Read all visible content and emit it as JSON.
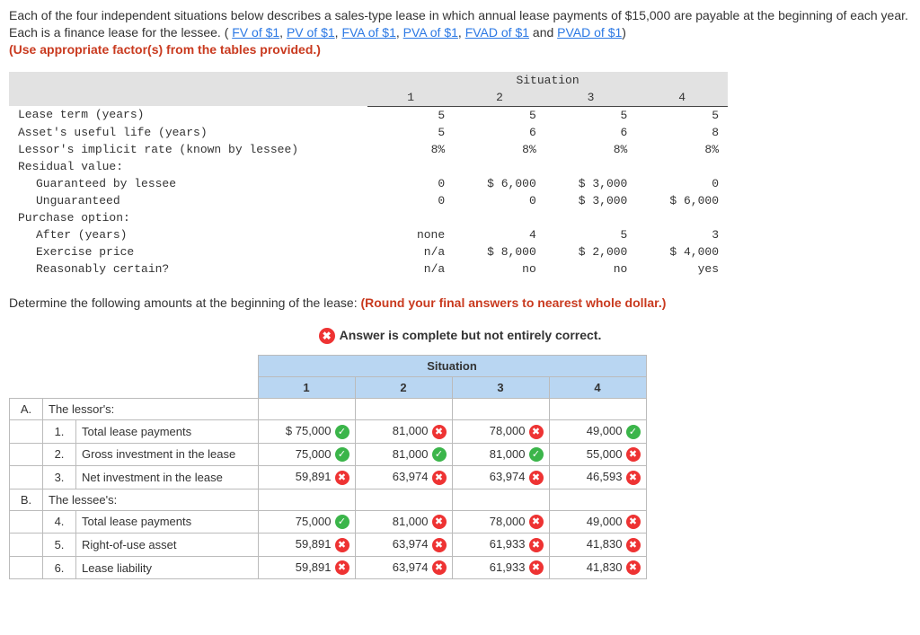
{
  "intro": {
    "text_a": "Each of the four independent situations below describes a sales-type lease in which annual lease payments of $15,000 are payable at the beginning of each year. Each is a finance lease for the lessee. (",
    "links": [
      "FV of $1",
      "PV of $1",
      "FVA of $1",
      "PVA of $1",
      "FVAD of $1",
      "PVAD of $1"
    ],
    "text_b": " and ",
    "closing": ")",
    "red_text": "(Use appropriate factor(s) from the tables provided.)"
  },
  "situation": {
    "header": "Situation",
    "cols": [
      "1",
      "2",
      "3",
      "4"
    ],
    "rows": [
      {
        "label": "Lease term (years)",
        "v": [
          "5",
          "5",
          "5",
          "5"
        ]
      },
      {
        "label": "Asset's useful life (years)",
        "v": [
          "5",
          "6",
          "6",
          "8"
        ]
      },
      {
        "label": "Lessor's implicit rate (known by lessee)",
        "v": [
          "8%",
          "8%",
          "8%",
          "8%"
        ]
      },
      {
        "label": "Residual value:",
        "v": [
          "",
          "",
          "",
          ""
        ]
      },
      {
        "label": "Guaranteed by lessee",
        "indent": 1,
        "v": [
          "0",
          "$ 6,000",
          "$ 3,000",
          "0"
        ]
      },
      {
        "label": "Unguaranteed",
        "indent": 1,
        "v": [
          "0",
          "0",
          "$ 3,000",
          "$ 6,000"
        ]
      },
      {
        "label": "Purchase option:",
        "v": [
          "",
          "",
          "",
          ""
        ]
      },
      {
        "label": "After (years)",
        "indent": 1,
        "v": [
          "none",
          "4",
          "5",
          "3"
        ]
      },
      {
        "label": "Exercise price",
        "indent": 1,
        "v": [
          "n/a",
          "$ 8,000",
          "$ 2,000",
          "$ 4,000"
        ]
      },
      {
        "label": "Reasonably certain?",
        "indent": 1,
        "v": [
          "n/a",
          "no",
          "no",
          "yes"
        ]
      }
    ]
  },
  "instruction": {
    "text": "Determine the following amounts at the beginning of the lease: ",
    "red": "(Round your final answers to nearest whole dollar.)"
  },
  "banner": "Answer is complete but not entirely correct.",
  "answer": {
    "header": "Situation",
    "cols": [
      "1",
      "2",
      "3",
      "4"
    ],
    "sections": [
      {
        "letter": "A.",
        "title": "The lessor's:",
        "rows": [
          {
            "num": "1.",
            "label": "Total lease payments",
            "vals": [
              {
                "t": "$   75,000",
                "m": "ok"
              },
              {
                "t": "81,000",
                "m": "bad"
              },
              {
                "t": "78,000",
                "m": "bad"
              },
              {
                "t": "49,000",
                "m": "ok"
              }
            ]
          },
          {
            "num": "2.",
            "label": "Gross investment in the lease",
            "vals": [
              {
                "t": "75,000",
                "m": "ok"
              },
              {
                "t": "81,000",
                "m": "ok"
              },
              {
                "t": "81,000",
                "m": "ok"
              },
              {
                "t": "55,000",
                "m": "bad"
              }
            ]
          },
          {
            "num": "3.",
            "label": "Net investment in the lease",
            "vals": [
              {
                "t": "59,891",
                "m": "bad"
              },
              {
                "t": "63,974",
                "m": "bad"
              },
              {
                "t": "63,974",
                "m": "bad"
              },
              {
                "t": "46,593",
                "m": "bad"
              }
            ]
          }
        ]
      },
      {
        "letter": "B.",
        "title": "The lessee's:",
        "rows": [
          {
            "num": "4.",
            "label": "Total lease payments",
            "vals": [
              {
                "t": "75,000",
                "m": "ok"
              },
              {
                "t": "81,000",
                "m": "bad"
              },
              {
                "t": "78,000",
                "m": "bad"
              },
              {
                "t": "49,000",
                "m": "bad"
              }
            ]
          },
          {
            "num": "5.",
            "label": "Right-of-use asset",
            "vals": [
              {
                "t": "59,891",
                "m": "bad"
              },
              {
                "t": "63,974",
                "m": "bad"
              },
              {
                "t": "61,933",
                "m": "bad"
              },
              {
                "t": "41,830",
                "m": "bad"
              }
            ]
          },
          {
            "num": "6.",
            "label": "Lease liability",
            "vals": [
              {
                "t": "59,891",
                "m": "bad"
              },
              {
                "t": "63,974",
                "m": "bad"
              },
              {
                "t": "61,933",
                "m": "bad"
              },
              {
                "t": "41,830",
                "m": "bad"
              }
            ]
          }
        ]
      }
    ]
  }
}
